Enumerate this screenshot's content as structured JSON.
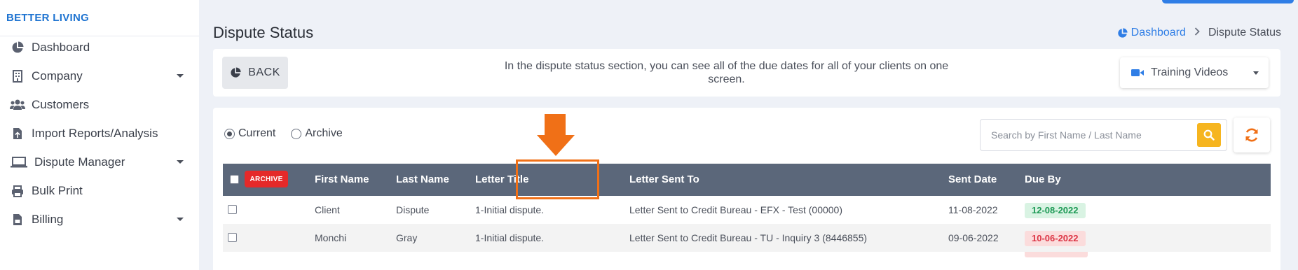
{
  "brand": "BETTER LIVING",
  "sidebar": {
    "items": [
      {
        "label": "Dashboard",
        "icon": "pie-chart-icon",
        "has_submenu": false
      },
      {
        "label": "Company",
        "icon": "building-icon",
        "has_submenu": true
      },
      {
        "label": "Customers",
        "icon": "users-icon",
        "has_submenu": false
      },
      {
        "label": "Import Reports/Analysis",
        "icon": "file-import-icon",
        "has_submenu": false
      },
      {
        "label": "Dispute Manager",
        "icon": "laptop-icon",
        "has_submenu": true
      },
      {
        "label": "Bulk Print",
        "icon": "printer-icon",
        "has_submenu": false
      },
      {
        "label": "Billing",
        "icon": "invoice-icon",
        "has_submenu": true
      }
    ]
  },
  "header": {
    "title": "Dispute Status",
    "breadcrumb": {
      "home": "Dashboard",
      "current": "Dispute Status"
    }
  },
  "info": {
    "back_label": "BACK",
    "description": "In the dispute status section, you can see all of the due dates for all of your clients on one screen.",
    "training_label": "Training Videos"
  },
  "filters": {
    "current_label": "Current",
    "archive_label": "Archive",
    "selected": "Current",
    "search_placeholder": "Search by First Name / Last Name"
  },
  "table": {
    "archive_badge": "ARCHIVE",
    "columns": [
      "First Name",
      "Last Name",
      "Letter Title",
      "Letter Sent To",
      "Sent Date",
      "Due By"
    ],
    "rows": [
      {
        "first": "Client",
        "last": "Dispute",
        "title": "1-Initial dispute.",
        "sent_to": "Letter Sent to Credit Bureau - EFX - Test (00000)",
        "sent_date": "11-08-2022",
        "due_by": "12-08-2022",
        "due_status": "on-time"
      },
      {
        "first": "Monchi",
        "last": "Gray",
        "title": "1-Initial dispute.",
        "sent_to": "Letter Sent to Credit Bureau - TU - Inquiry 3 (8446855)",
        "sent_date": "09-06-2022",
        "due_by": "10-06-2022",
        "due_status": "overdue"
      }
    ]
  },
  "colors": {
    "brand": "#1f74d1",
    "table_header": "#5b677a",
    "archive_badge": "#e52929",
    "search_button": "#f6b51f",
    "refresh_icon": "#f07017",
    "annotation": "#f07017",
    "due_green": "#1d9a55",
    "due_red": "#dc3545"
  }
}
